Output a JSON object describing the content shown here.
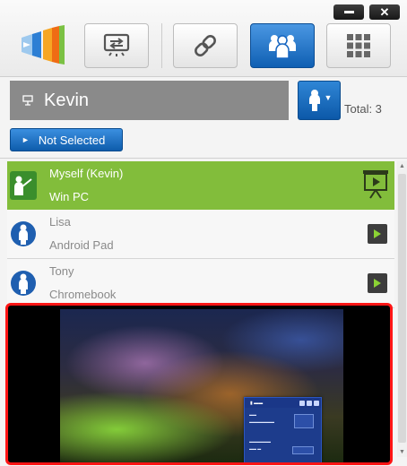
{
  "toolbar": {
    "buttons": [
      "logo",
      "screen-mirror",
      "link",
      "users",
      "grid"
    ]
  },
  "presenter": {
    "name": "Kevin"
  },
  "total_label": "Total: 3",
  "not_selected_label": "Not Selected",
  "users": [
    {
      "name": "Myself (Kevin)",
      "device": "Win PC"
    },
    {
      "name": "Lisa",
      "device": "Android Pad"
    },
    {
      "name": "Tony",
      "device": "Chromebook"
    }
  ],
  "colors": {
    "accent_blue": "#0f5fb3",
    "self_row_green": "#82bd3b",
    "presenter_bar": "#8a8a8a",
    "preview_border": "#ff1515"
  }
}
